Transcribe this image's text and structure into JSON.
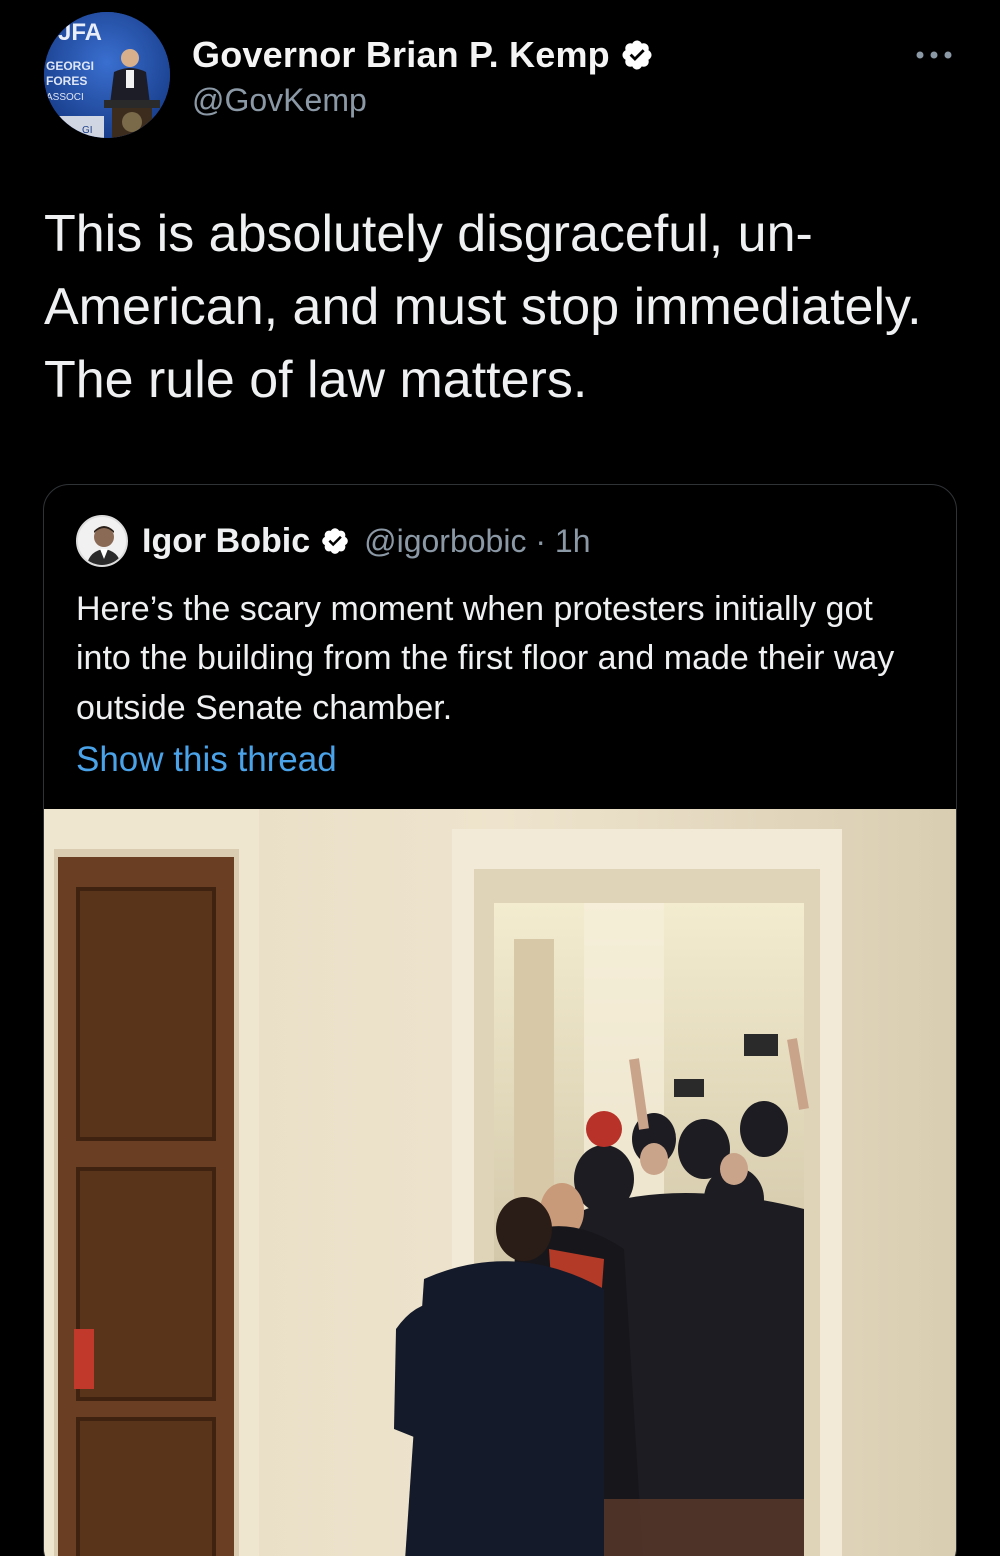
{
  "author": {
    "name": "Governor Brian P. Kemp",
    "handle": "@GovKemp",
    "avatar_logo_text": "GFA GEORGIA FORESTRY ASSOCIATION"
  },
  "menu_icon": "more-horizontal-icon",
  "tweet": {
    "text": "This is absolutely disgraceful, un-American, and must stop immediately. The rule of law matters."
  },
  "quote": {
    "name": "Igor Bobic",
    "handle": "@igorbobic · 1h",
    "text": "Here’s the scary moment when protesters initially got into the building from the first floor and made their way outside Senate chamber.",
    "show_thread": "Show this thread"
  },
  "colors": {
    "background": "#000000",
    "text": "#e7e9ea",
    "secondary": "#8b98a5",
    "link": "#4aa3e8",
    "verified": "#ffffff"
  }
}
